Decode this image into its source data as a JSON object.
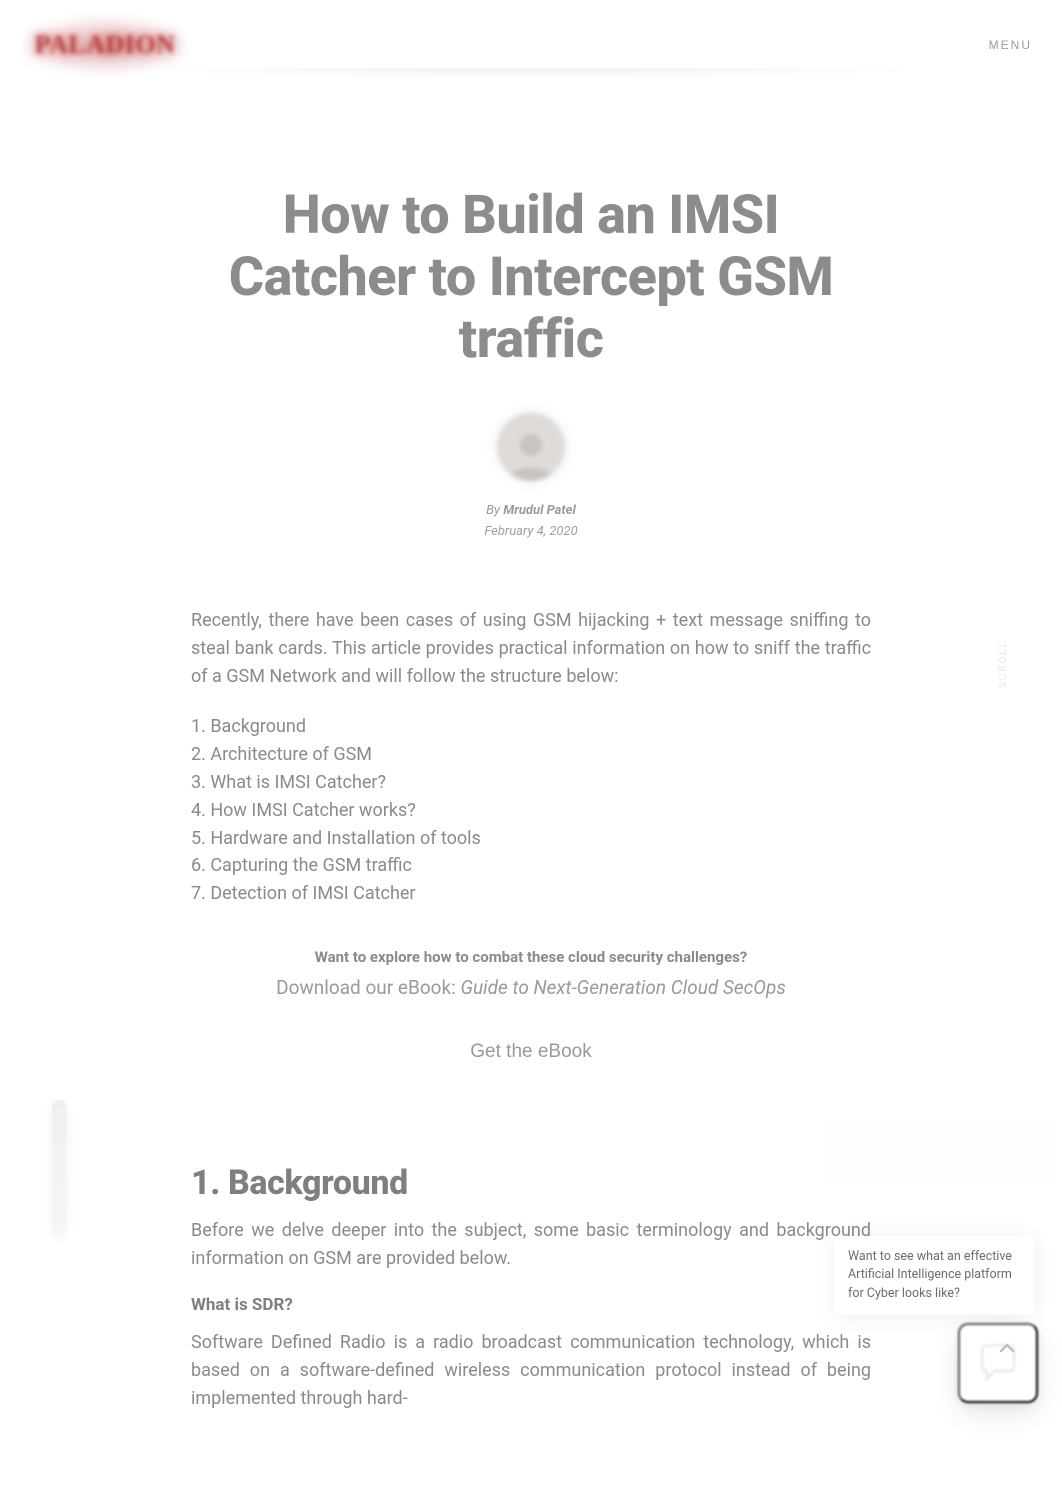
{
  "brand": {
    "logo_text": "PALADION"
  },
  "nav": {
    "menu_label": "MENU"
  },
  "post": {
    "title": "How to Build an IMSI Catcher to Intercept GSM traffic",
    "by_word": "By",
    "author": "Mrudul Patel",
    "date": "February 4, 2020",
    "intro": "Recently, there have been cases of using GSM hijacking + text message sniffing to steal bank cards. This article provides practical information on how to sniff the traffic of a GSM Network and will follow the structure below:",
    "outline": [
      "1. Background",
      "2. Architecture of GSM",
      "3. What is IMSI Catcher?",
      "4. How IMSI Catcher works?",
      "5. Hardware and Installation of tools",
      "6. Capturing the GSM traffic",
      "7. Detection of IMSI Catcher"
    ]
  },
  "cta": {
    "headline": "Want to explore how to combat these cloud security challenges?",
    "sub_lead": "Download our eBook: ",
    "ebook_name": "Guide to Next-Generation Cloud SecOps",
    "button_label": "Get the eBook"
  },
  "section": {
    "heading": "1. Background",
    "para": "Before we delve deeper into the subject, some basic terminology and background information on GSM are provided below.",
    "sub_heading": "What is SDR?",
    "para2": "Software Defined Radio is a radio broadcast communication technology, which is based on a software-defined wireless communication protocol instead of being implemented through hard-"
  },
  "rail": {
    "vertical_text": "SCROLL"
  },
  "chat_tip": "Want to see what an effective Artificial Intelligence platform for Cyber looks like?"
}
